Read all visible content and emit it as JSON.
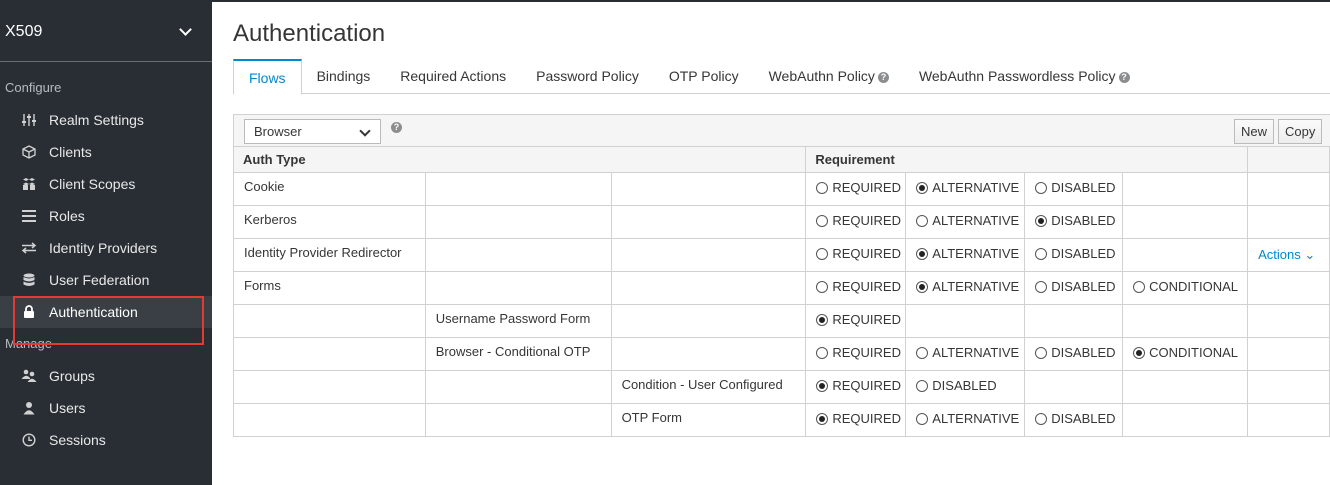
{
  "sidebar": {
    "realm": "X509",
    "configure_label": "Configure",
    "configure_items": [
      {
        "label": "Realm Settings",
        "icon": "sliders-icon"
      },
      {
        "label": "Clients",
        "icon": "cube-icon"
      },
      {
        "label": "Client Scopes",
        "icon": "cubes-icon"
      },
      {
        "label": "Roles",
        "icon": "list-icon"
      },
      {
        "label": "Identity Providers",
        "icon": "exchange-icon"
      },
      {
        "label": "User Federation",
        "icon": "database-icon"
      },
      {
        "label": "Authentication",
        "icon": "lock-icon"
      }
    ],
    "manage_label": "Manage",
    "manage_items": [
      {
        "label": "Groups",
        "icon": "users-icon"
      },
      {
        "label": "Users",
        "icon": "user-icon"
      },
      {
        "label": "Sessions",
        "icon": "clock-icon"
      }
    ]
  },
  "main": {
    "title": "Authentication",
    "tabs": [
      "Flows",
      "Bindings",
      "Required Actions",
      "Password Policy",
      "OTP Policy",
      "WebAuthn Policy",
      "WebAuthn Passwordless Policy"
    ],
    "active_tab": "Flows"
  },
  "toolbar": {
    "flow_select": "Browser",
    "new_label": "New",
    "copy_label": "Copy"
  },
  "table": {
    "headers": {
      "auth_type": "Auth Type",
      "requirement": "Requirement"
    },
    "rows": [
      {
        "c1": "Cookie",
        "c2": "",
        "c3": "",
        "opts": [
          "REQUIRED",
          "ALTERNATIVE",
          "DISABLED"
        ],
        "selected": "ALTERNATIVE",
        "action": ""
      },
      {
        "c1": "Kerberos",
        "c2": "",
        "c3": "",
        "opts": [
          "REQUIRED",
          "ALTERNATIVE",
          "DISABLED"
        ],
        "selected": "DISABLED",
        "action": ""
      },
      {
        "c1": "Identity Provider Redirector",
        "c2": "",
        "c3": "",
        "opts": [
          "REQUIRED",
          "ALTERNATIVE",
          "DISABLED"
        ],
        "selected": "ALTERNATIVE",
        "action": "Actions"
      },
      {
        "c1": "Forms",
        "c2": "",
        "c3": "",
        "opts": [
          "REQUIRED",
          "ALTERNATIVE",
          "DISABLED",
          "CONDITIONAL"
        ],
        "selected": "ALTERNATIVE",
        "action": ""
      },
      {
        "c1": "",
        "c2": "Username Password Form",
        "c3": "",
        "opts": [
          "REQUIRED"
        ],
        "selected": "REQUIRED",
        "action": ""
      },
      {
        "c1": "",
        "c2": "Browser - Conditional OTP",
        "c3": "",
        "opts": [
          "REQUIRED",
          "ALTERNATIVE",
          "DISABLED",
          "CONDITIONAL"
        ],
        "selected": "CONDITIONAL",
        "action": ""
      },
      {
        "c1": "",
        "c2": "",
        "c3": "Condition - User Configured",
        "opts": [
          "REQUIRED",
          "DISABLED"
        ],
        "selected": "REQUIRED",
        "action": ""
      },
      {
        "c1": "",
        "c2": "",
        "c3": "OTP Form",
        "opts": [
          "REQUIRED",
          "ALTERNATIVE",
          "DISABLED"
        ],
        "selected": "REQUIRED",
        "action": ""
      }
    ]
  }
}
